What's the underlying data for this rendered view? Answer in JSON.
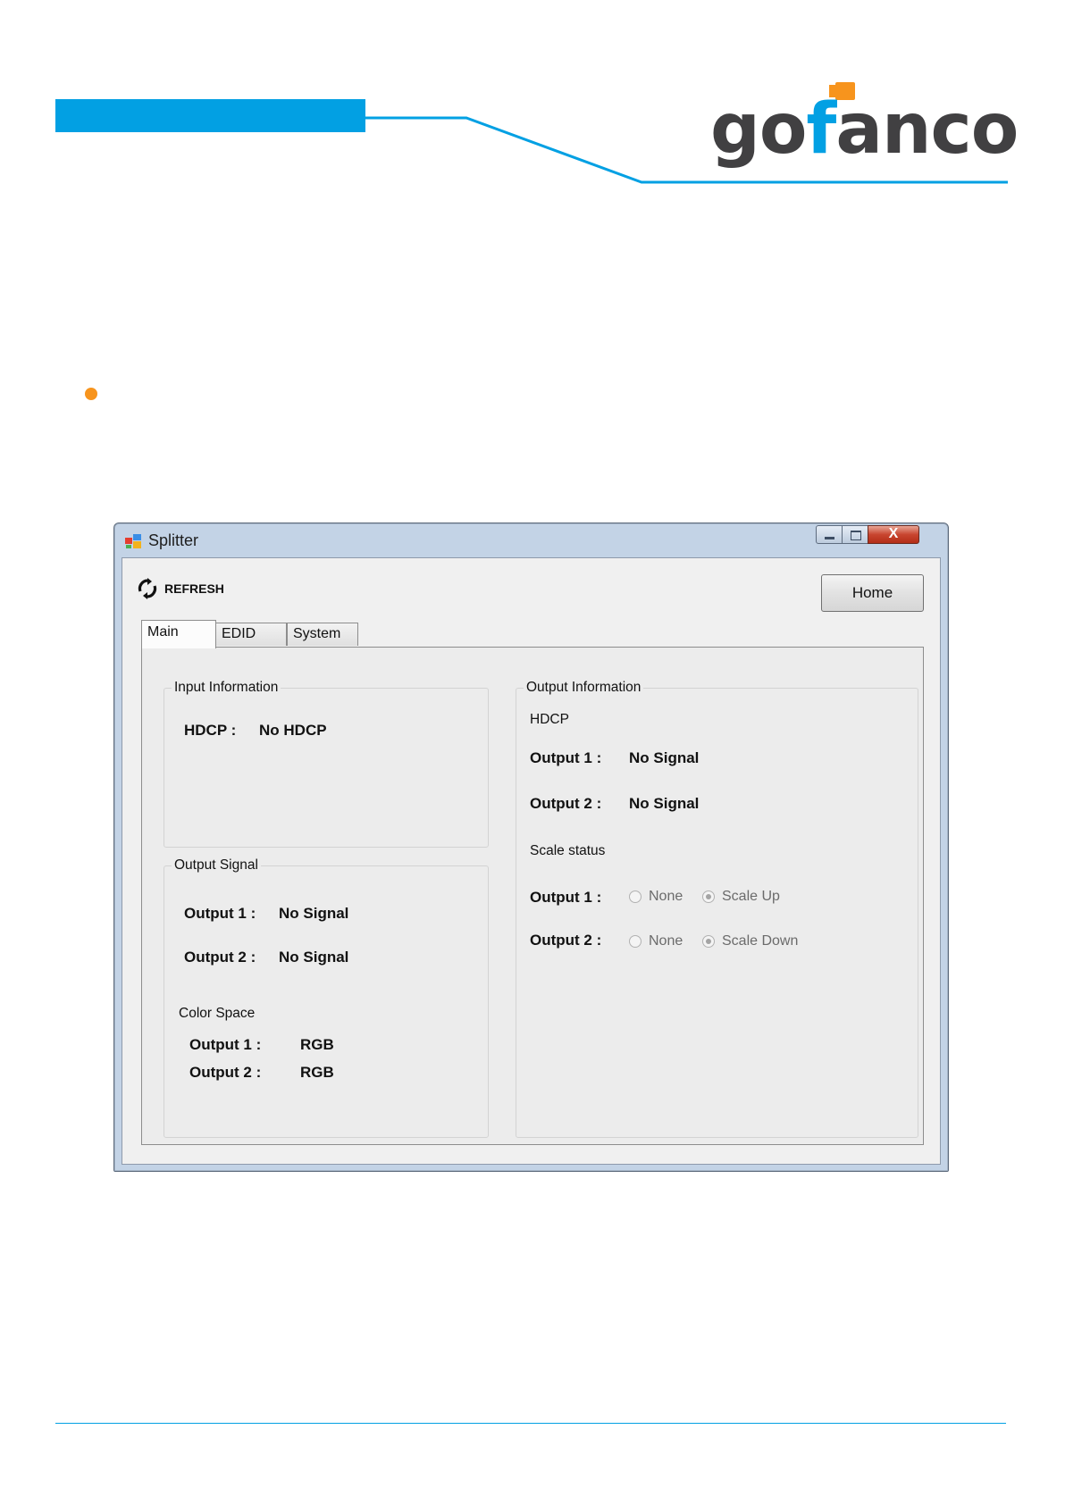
{
  "brand": {
    "logo_text": "gofanco",
    "colors": {
      "accent": "#02a0e3",
      "plug": "#f7941d",
      "logo": "#414042"
    }
  },
  "window": {
    "title": "Splitter",
    "close_glyph": "X",
    "refresh_label": "REFRESH",
    "home_label": "Home",
    "tabs": [
      "Main",
      "EDID",
      "System"
    ],
    "active_tab": "Main"
  },
  "input_info": {
    "title": "Input Information",
    "hdcp_label": "HDCP :",
    "hdcp_value": "No HDCP"
  },
  "output_signal": {
    "title": "Output Signal",
    "rows": [
      {
        "label": "Output 1 :",
        "value": "No Signal"
      },
      {
        "label": "Output 2 :",
        "value": "No Signal"
      }
    ],
    "color_space": {
      "title": "Color Space",
      "rows": [
        {
          "label": "Output 1 :",
          "value": "RGB"
        },
        {
          "label": "Output 2 :",
          "value": "RGB"
        }
      ]
    }
  },
  "output_info": {
    "title": "Output Information",
    "hdcp_title": "HDCP",
    "hdcp_rows": [
      {
        "label": "Output 1 :",
        "value": "No Signal"
      },
      {
        "label": "Output 2 :",
        "value": "No Signal"
      }
    ],
    "scale_title": "Scale status",
    "scale_rows": [
      {
        "label": "Output 1 :",
        "options": [
          "None",
          "Scale Up"
        ],
        "selected": "Scale Up"
      },
      {
        "label": "Output 2 :",
        "options": [
          "None",
          "Scale Down"
        ],
        "selected": "Scale Down"
      }
    ]
  }
}
